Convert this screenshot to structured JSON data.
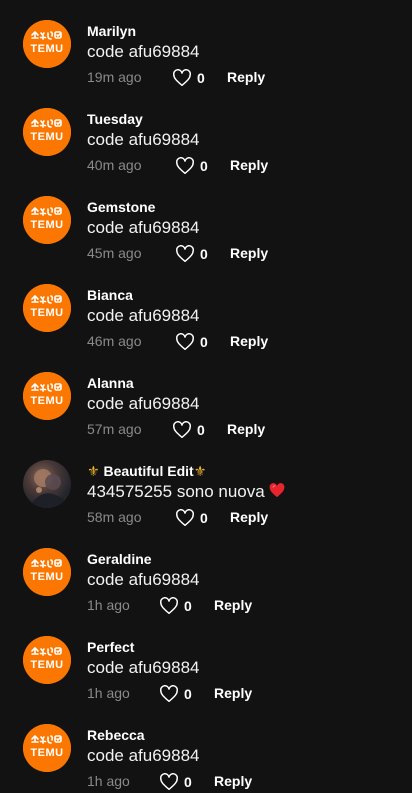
{
  "brand_color": "#fb7701",
  "avatar_logo_text": "TEMU",
  "comments": [
    {
      "username": "Marilyn",
      "text": "code afu69884",
      "time": "19m ago",
      "likes": "0",
      "reply_label": "Reply",
      "avatar": "temu-logo"
    },
    {
      "username": "Tuesday",
      "text": "code afu69884",
      "time": "40m ago",
      "likes": "0",
      "reply_label": "Reply",
      "avatar": "temu-logo"
    },
    {
      "username": "Gemstone",
      "text": "code afu69884",
      "time": "45m ago",
      "likes": "0",
      "reply_label": "Reply",
      "avatar": "temu-logo"
    },
    {
      "username": "Bianca",
      "text": "code afu69884",
      "time": "46m ago",
      "likes": "0",
      "reply_label": "Reply",
      "avatar": "temu-logo"
    },
    {
      "username": "Alanna",
      "text": "code afu69884",
      "time": "57m ago",
      "likes": "0",
      "reply_label": "Reply",
      "avatar": "temu-logo"
    },
    {
      "username": "Beautiful Edit",
      "username_prefix": "⚜",
      "username_suffix": "⚜",
      "text": "434575255 sono nuova",
      "text_emoji": "red-heart",
      "time": "58m ago",
      "likes": "0",
      "reply_label": "Reply",
      "avatar": "profile-photo"
    },
    {
      "username": "Geraldine",
      "text": "code afu69884",
      "time": "1h ago",
      "likes": "0",
      "reply_label": "Reply",
      "avatar": "temu-logo"
    },
    {
      "username": "Perfect",
      "text": "code afu69884",
      "time": "1h ago",
      "likes": "0",
      "reply_label": "Reply",
      "avatar": "temu-logo"
    },
    {
      "username": "Rebecca",
      "text": "code afu69884",
      "time": "1h ago",
      "likes": "0",
      "reply_label": "Reply",
      "avatar": "temu-logo"
    }
  ]
}
